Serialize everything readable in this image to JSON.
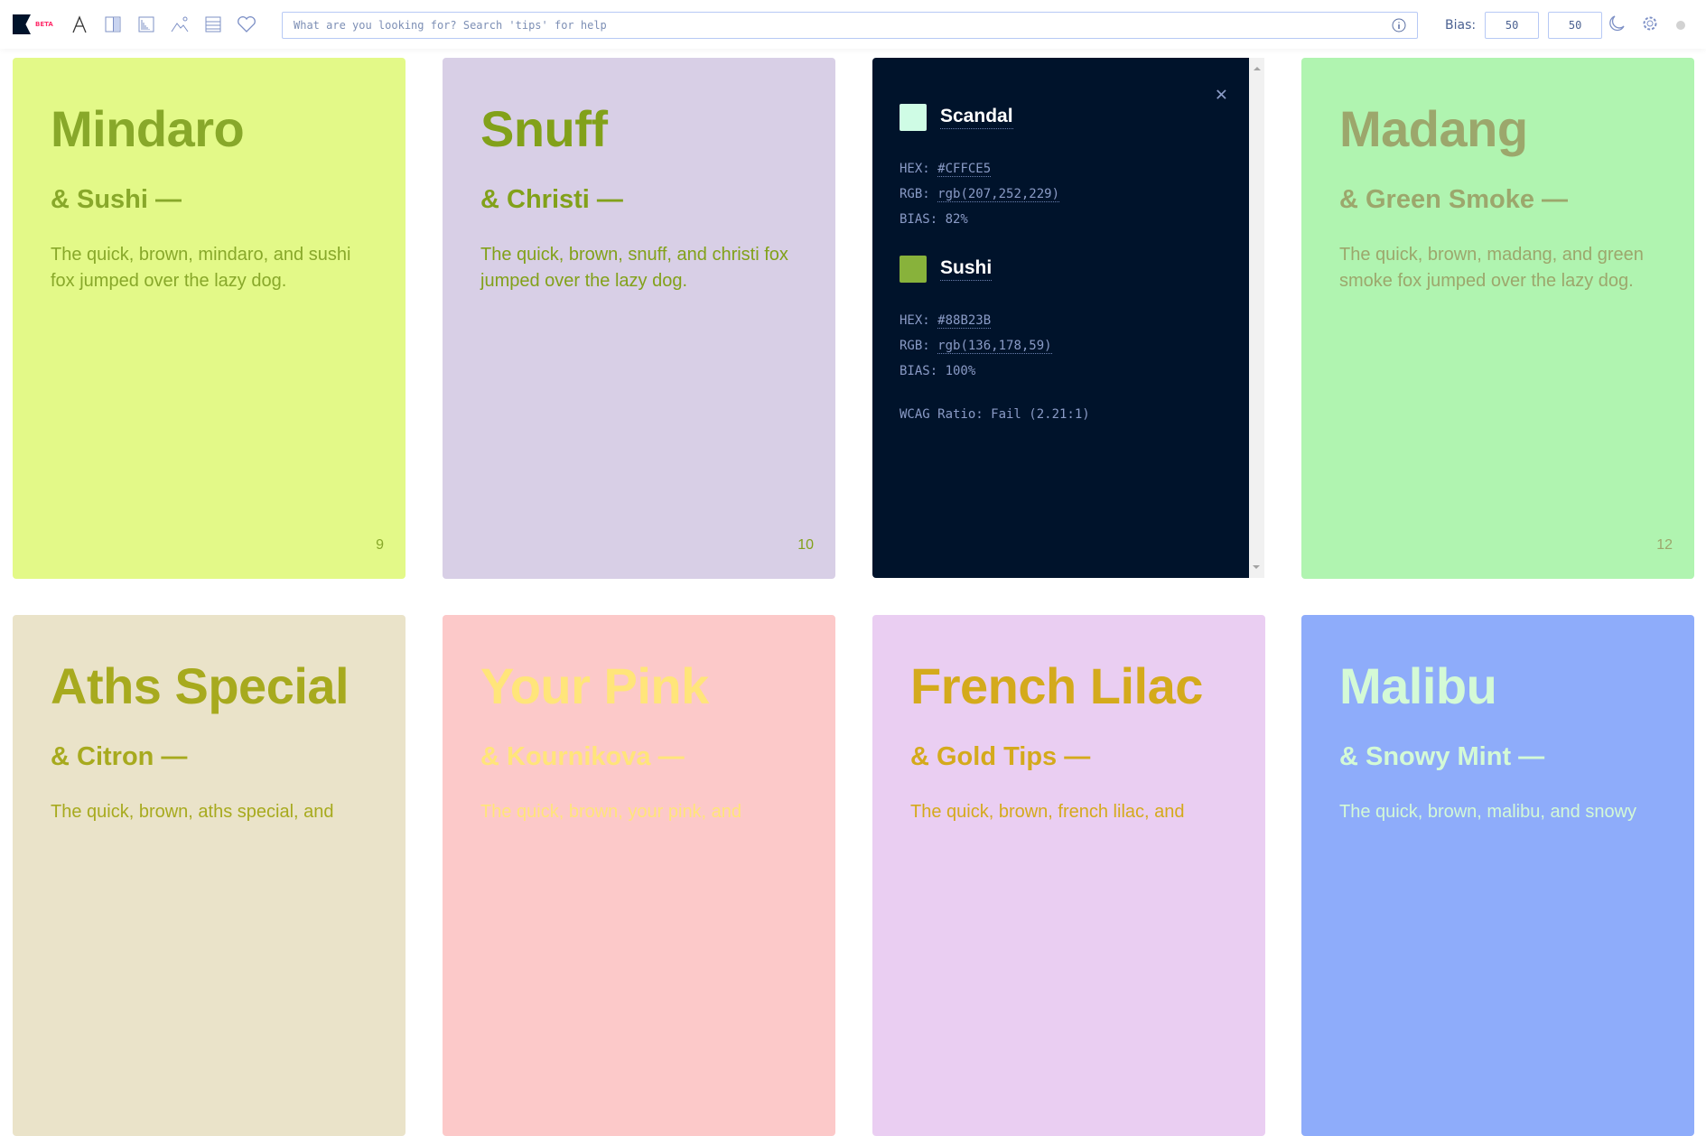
{
  "header": {
    "beta": "BETA",
    "search_placeholder": "What are you looking for? Search 'tips' for help",
    "bias_label": "Bias:",
    "bias_values": [
      "50",
      "50"
    ]
  },
  "cards": [
    {
      "title": "Mindaro",
      "pair": "& Sushi —",
      "text": "The quick, brown, mindaro, and sushi fox jumped over the lazy dog.",
      "num": "9",
      "bg": "#E3F988",
      "fg": "#88A82A"
    },
    {
      "title": "Snuff",
      "pair": "& Christi —",
      "text": "The quick, brown, snuff, and christi fox jumped over the lazy dog.",
      "num": "10",
      "bg": "#D8CFE6",
      "fg": "#82A11A"
    },
    {
      "title": "Madang",
      "pair": "& Green Smoke —",
      "text": "The quick, brown, madang, and green smoke fox jumped over the lazy dog.",
      "num": "12",
      "bg": "#B0F4B0",
      "fg": "#9CA76C"
    },
    {
      "title": "Aths Special",
      "pair": "& Citron —",
      "text": "The quick, brown, aths special, and",
      "num": "",
      "bg": "#EAE3C9",
      "fg": "#A7AA1E"
    },
    {
      "title": "Your Pink",
      "pair": "& Kournikova —",
      "text": "The quick, brown, your pink, and",
      "num": "",
      "bg": "#FCC9C9",
      "fg": "#FFE57A"
    },
    {
      "title": "French Lilac",
      "pair": "& Gold Tips —",
      "text": "The quick, brown, french lilac, and",
      "num": "",
      "bg": "#EACEF2",
      "fg": "#D4AA1C"
    },
    {
      "title": "Malibu",
      "pair": "& Snowy Mint —",
      "text": "The quick, brown, malibu, and snowy",
      "num": "",
      "bg": "#8EACFA",
      "fg": "#D4FAD6"
    }
  ],
  "detail": {
    "colors": [
      {
        "name": "Scandal",
        "swatch": "#CFFCE5",
        "hex_label": "HEX:",
        "hex": "#CFFCE5",
        "rgb_label": "RGB:",
        "rgb": "rgb(207,252,229)",
        "bias": "BIAS: 82%"
      },
      {
        "name": "Sushi",
        "swatch": "#88B23B",
        "hex_label": "HEX:",
        "hex": "#88B23B",
        "rgb_label": "RGB:",
        "rgb": "rgb(136,178,59)",
        "bias": "BIAS: 100%"
      }
    ],
    "wcag": "WCAG Ratio: Fail (2.21:1)"
  }
}
